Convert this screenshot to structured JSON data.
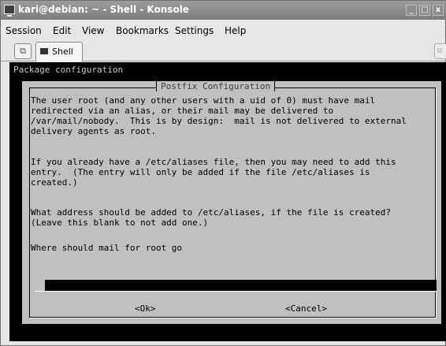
{
  "window": {
    "title": "kari@debian: ~ - Shell - Konsole",
    "minimize_glyph": "_",
    "maximize_glyph": "□",
    "close_glyph": "x"
  },
  "menubar": {
    "items": [
      "Session",
      "Edit",
      "View",
      "Bookmarks",
      "Settings",
      "Help"
    ]
  },
  "tabs": [
    {
      "label": "Shell",
      "icon": "terminal-icon",
      "active": true
    }
  ],
  "terminal": {
    "heading": "Package configuration",
    "dialog": {
      "title": "Postfix Configuration",
      "paragraphs": [
        "The user root (and any other users with a uid of 0) must have mail\nredirected via an alias, or their mail may be delivered to\n/var/mail/nobody.  This is by design:  mail is not delivered to external\ndelivery agents as root.",
        "If you already have a /etc/aliases file, then you may need to add this\nentry.  (The entry will only be added if the file /etc/aliases is\ncreated.)",
        "What address should be added to /etc/aliases, if the file is created?\n(Leave this blank to not add one.)",
        "Where should mail for root go"
      ],
      "input_value": "",
      "ok_label": "<Ok>",
      "cancel_label": "<Cancel>"
    }
  },
  "colors": {
    "terminal_bg": "#000000",
    "dialog_bg": "#c0c0c0",
    "titlebar": "#8a8a8a"
  }
}
